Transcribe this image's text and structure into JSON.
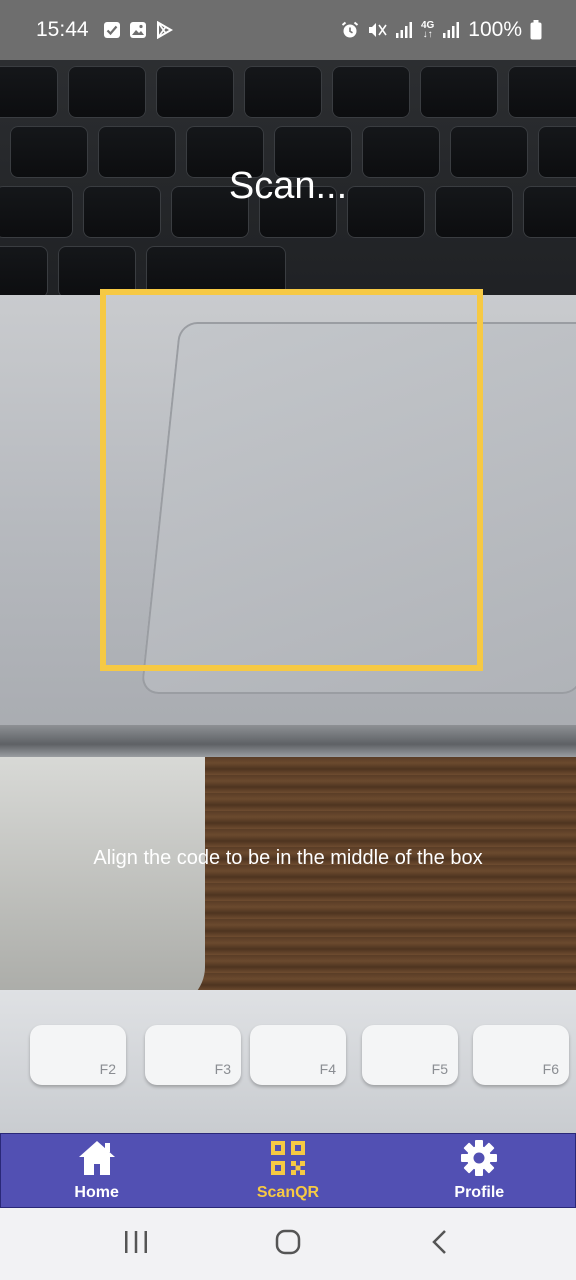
{
  "status_bar": {
    "time": "15:44",
    "left_icons": [
      "check-notification-icon",
      "image-notification-icon",
      "play-store-icon"
    ],
    "right_icons": [
      "alarm-icon",
      "mute-icon",
      "signal-icon",
      "4g-icon",
      "signal-icon"
    ],
    "network": "4G",
    "battery": "100%"
  },
  "scanner": {
    "title": "Scan...",
    "hint": "Align the code to be in the middle of the box",
    "frame_color": "#f6c944"
  },
  "nav": {
    "items": [
      {
        "label": "Home",
        "icon": "home-icon",
        "active": false
      },
      {
        "label": "ScanQR",
        "icon": "qr-code-icon",
        "active": true
      },
      {
        "label": "Profile",
        "icon": "gear-icon",
        "active": false
      }
    ],
    "background": "#5250b3",
    "active_color": "#f6c944"
  },
  "system_nav": {
    "buttons": [
      "recent-apps-icon",
      "home-circle-icon",
      "back-icon"
    ]
  },
  "keyboard_labels": [
    "F2",
    "F3",
    "F4",
    "F5",
    "F6"
  ]
}
